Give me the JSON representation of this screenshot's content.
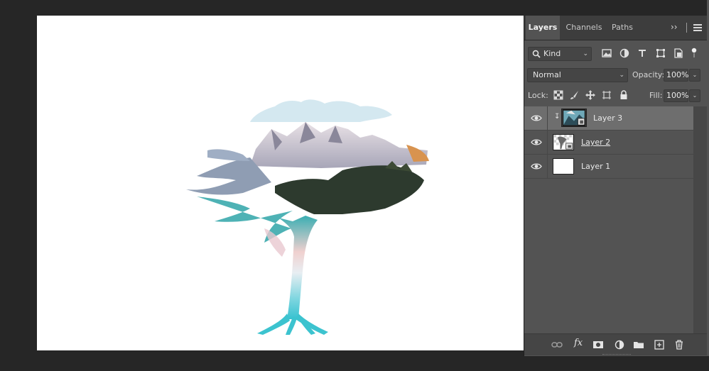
{
  "panel": {
    "tabs": [
      {
        "label": "Layers"
      },
      {
        "label": "Channels"
      },
      {
        "label": "Paths"
      }
    ],
    "collapse_icon": "double-chevron-right-icon",
    "menu_icon": "hamburger-menu-icon",
    "filter": {
      "kind_label": "Kind",
      "icons": [
        "image-filter-icon",
        "adjustment-filter-icon",
        "type-filter-icon",
        "shape-filter-icon",
        "smart-object-filter-icon",
        "filter-toggle-icon"
      ]
    },
    "blend_mode": "Normal",
    "opacity_label": "Opacity:",
    "opacity_value": "100%",
    "lock_label": "Lock:",
    "lock_icons": [
      "lock-transparent-icon",
      "lock-image-icon",
      "lock-position-icon",
      "lock-artboard-icon",
      "lock-all-icon"
    ],
    "fill_label": "Fill:",
    "fill_value": "100%",
    "layers": [
      {
        "name": "Layer 3",
        "visible": true,
        "selected": true,
        "clipped": true
      },
      {
        "name": "Layer 2",
        "visible": true,
        "selected": false,
        "clipped": false
      },
      {
        "name": "Layer 1",
        "visible": true,
        "selected": false,
        "clipped": false
      }
    ],
    "footer_icons": [
      "link-layers-icon",
      "fx-icon",
      "add-mask-icon",
      "adjustment-layer-icon",
      "group-folder-icon",
      "new-layer-icon",
      "trash-icon"
    ],
    "fx_label": "fx"
  },
  "colors": {
    "workspace": "#262626",
    "panel": "#535353",
    "selected_row": "#6e6e6e",
    "canvas": "#ffffff"
  }
}
